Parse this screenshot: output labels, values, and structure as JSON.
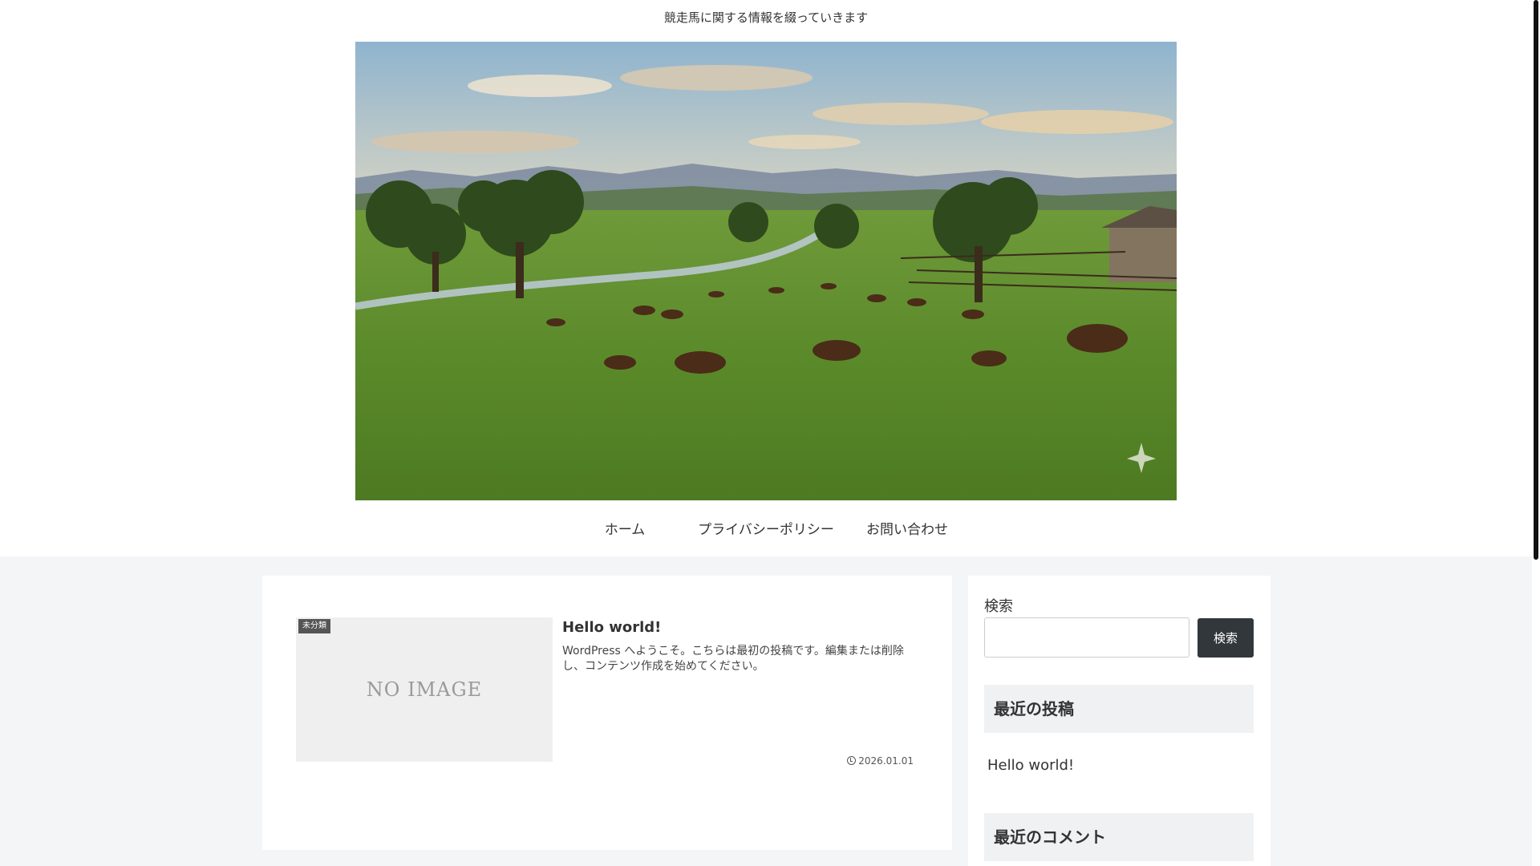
{
  "header": {
    "tagline": "競走馬に関する情報を綴っていきます"
  },
  "nav": {
    "items": [
      {
        "label": "ホーム"
      },
      {
        "label": "プライバシーポリシー"
      },
      {
        "label": "お問い合わせ"
      }
    ]
  },
  "main": {
    "posts": [
      {
        "category": "未分類",
        "thumbnail_text": "NO IMAGE",
        "title": "Hello world!",
        "snippet": "WordPress へようこそ。こちらは最初の投稿です。編集または削除し、コンテンツ作成を始めてください。",
        "date": "2026.01.01"
      }
    ]
  },
  "sidebar": {
    "search_label": "検索",
    "search_button": "検索",
    "search_value": "",
    "recent_posts_title": "最近の投稿",
    "recent_posts": [
      "Hello world!"
    ],
    "recent_comments_title": "最近のコメント"
  },
  "colors": {
    "page_bg": "#f4f5f7",
    "search_button_bg": "#32373c",
    "category_label_bg": "#555555"
  }
}
